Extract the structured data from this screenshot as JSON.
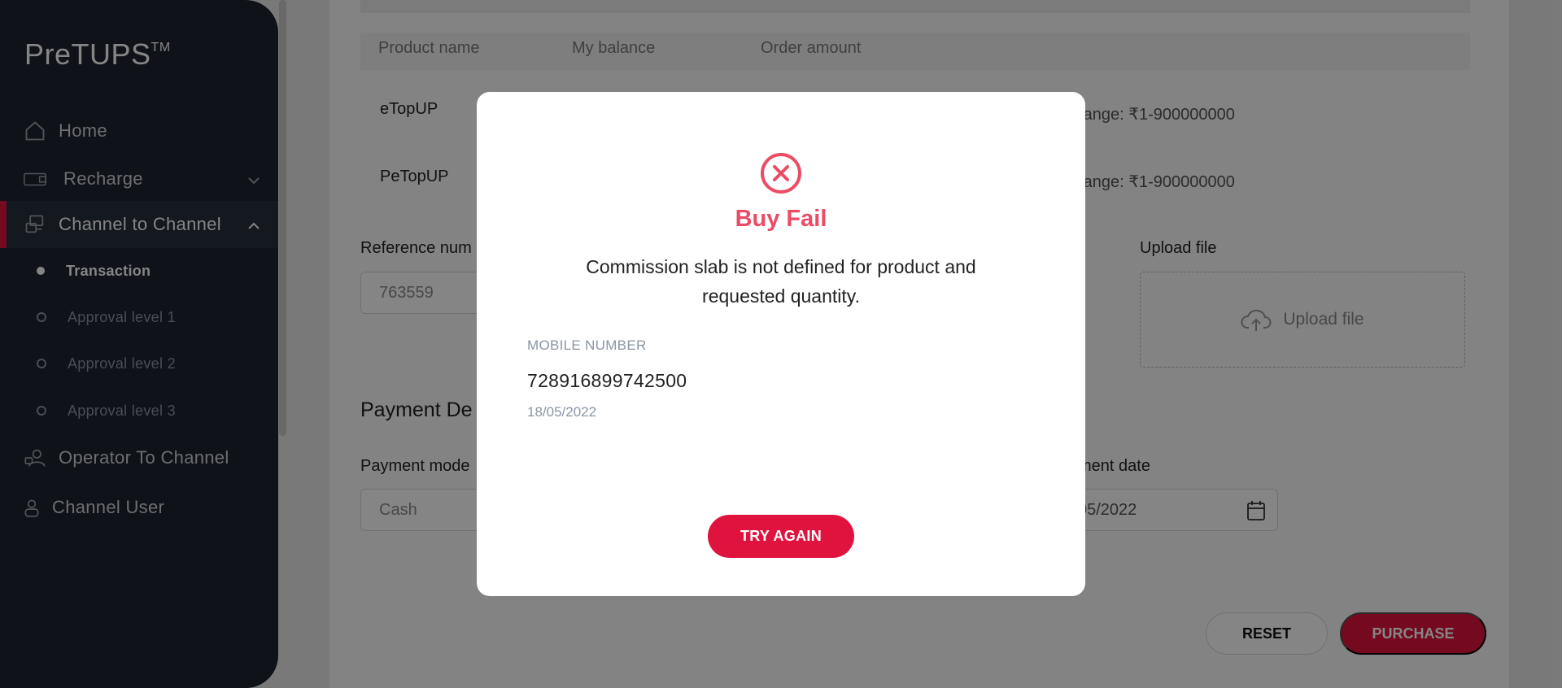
{
  "app": {
    "logo_text": "PreTUPS",
    "logo_mark": "TM"
  },
  "sidebar": {
    "items": [
      {
        "label": "Home",
        "icon": "home-icon"
      },
      {
        "label": "Recharge",
        "icon": "recharge-icon"
      },
      {
        "label": "Channel to Channel",
        "icon": "channel-icon",
        "active": true
      },
      {
        "label": "Operator To Channel",
        "icon": "operator-icon"
      },
      {
        "label": "Channel User",
        "icon": "user-icon"
      }
    ],
    "subitems": [
      {
        "label": "Transaction",
        "active": true
      },
      {
        "label": "Approval level 1"
      },
      {
        "label": "Approval level 2"
      },
      {
        "label": "Approval level 3"
      }
    ]
  },
  "table": {
    "headers": [
      "Product name",
      "My balance",
      "Order amount"
    ],
    "rows": [
      {
        "product": "eTopUP",
        "range": "range: ₹1-900000000"
      },
      {
        "product": "PeTopUP",
        "range": "range: ₹1-900000000"
      }
    ]
  },
  "form": {
    "reference_label": "Reference num",
    "reference_value": "763559",
    "upload_label": "Upload file",
    "upload_button": "Upload file",
    "section_title": "Payment De",
    "payment_mode_label": "Payment mode",
    "payment_mode_value": "Cash",
    "payment_date_label": "ment date",
    "payment_date_value": "05/2022"
  },
  "actions": {
    "reset": "RESET",
    "purchase": "PURCHASE"
  },
  "modal": {
    "title": "Buy Fail",
    "message": "Commission slab is not defined for product and requested quantity.",
    "mobile_label": "MOBILE NUMBER",
    "mobile_number": "728916899742500",
    "date": "18/05/2022",
    "button": "TRY AGAIN"
  },
  "colors": {
    "brand_red": "#e0133f",
    "fail_red": "#ec4b65",
    "sidebar_bg": "#1d2330"
  }
}
